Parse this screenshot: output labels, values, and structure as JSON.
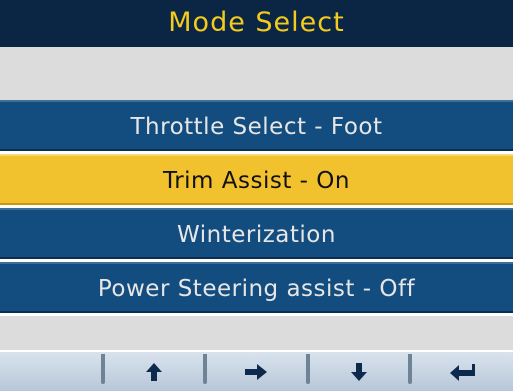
{
  "title": "Mode Select",
  "menu": {
    "items": [
      {
        "label": "Throttle Select - Foot",
        "selected": false
      },
      {
        "label": "Trim Assist - On",
        "selected": true
      },
      {
        "label": "Winterization",
        "selected": false
      },
      {
        "label": "Power Steering assist - Off",
        "selected": false
      }
    ]
  },
  "softkeys": [
    {
      "icon": "blank"
    },
    {
      "icon": "arrow-up-icon"
    },
    {
      "icon": "arrow-right-icon"
    },
    {
      "icon": "arrow-down-icon"
    },
    {
      "icon": "enter-back-icon"
    }
  ],
  "colors": {
    "title_bg": "#0b2545",
    "title_text": "#f2cb1d",
    "item_bg": "#134c7e",
    "item_text": "#e6e6e6",
    "selected_bg": "#f2c12e",
    "selected_text": "#111111",
    "blank_bg": "#dcdcdc"
  }
}
